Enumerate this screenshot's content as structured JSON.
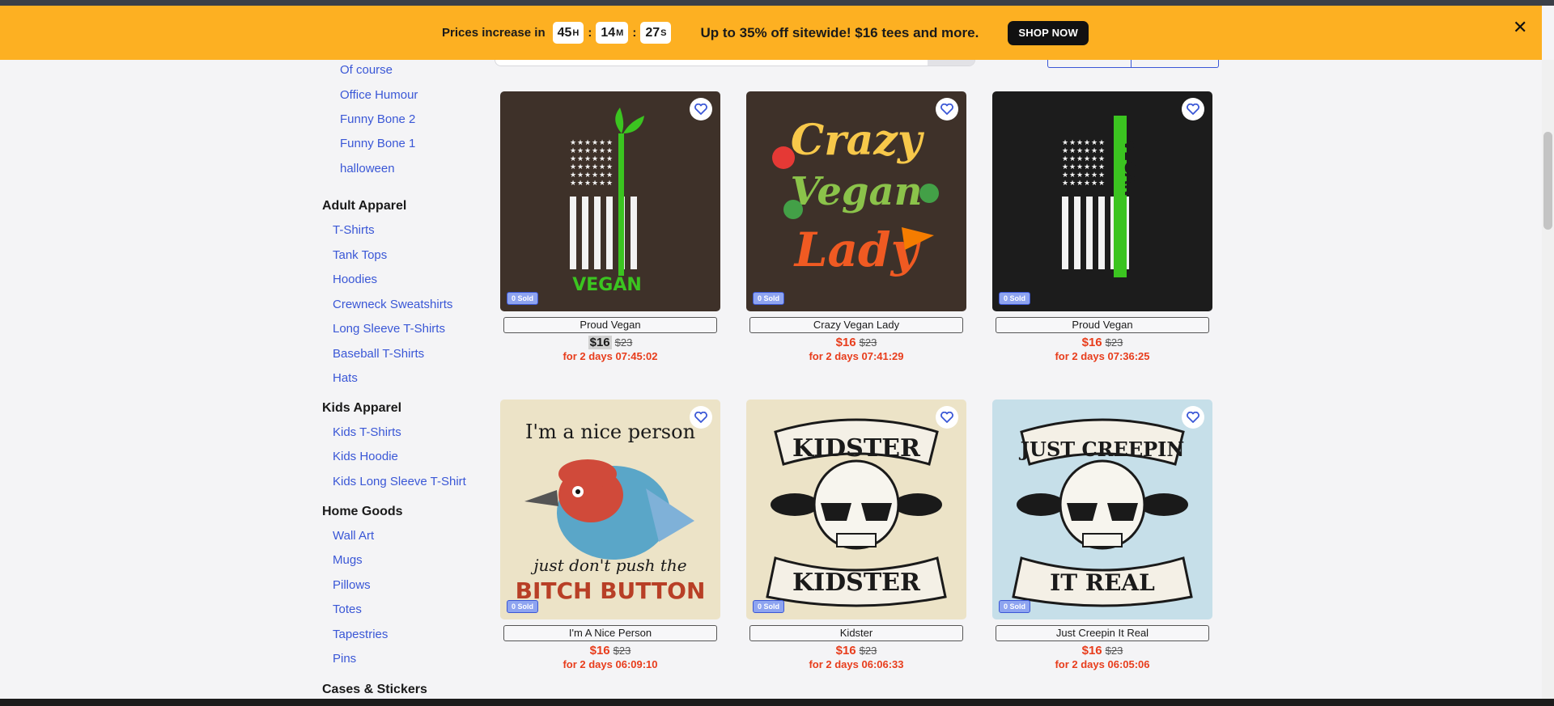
{
  "banner": {
    "prices_text": "Prices increase in",
    "hours": "45",
    "hours_unit": "H",
    "minutes": "14",
    "minutes_unit": "M",
    "seconds": "27",
    "seconds_unit": "S",
    "promo": "Up to 35% off sitewide! $16 tees and more.",
    "shop_now": "SHOP NOW",
    "close": "✕"
  },
  "sidebar": {
    "collections": [
      "Of course",
      "Office Humour",
      "Funny Bone 2",
      "Funny Bone 1",
      "halloween"
    ],
    "adult": {
      "title": "Adult Apparel",
      "items": [
        "T-Shirts",
        "Tank Tops",
        "Hoodies",
        "Crewneck Sweatshirts",
        "Long Sleeve T-Shirts",
        "Baseball T-Shirts",
        "Hats"
      ]
    },
    "kids": {
      "title": "Kids Apparel",
      "items": [
        "Kids T-Shirts",
        "Kids Hoodie",
        "Kids Long Sleeve T-Shirt"
      ]
    },
    "home": {
      "title": "Home Goods",
      "items": [
        "Wall Art",
        "Mugs",
        "Pillows",
        "Totes",
        "Tapestries",
        "Pins"
      ]
    },
    "cases": {
      "title": "Cases & Stickers"
    }
  },
  "products": [
    {
      "name": "Proud Vegan",
      "price": "$16",
      "was": "$23",
      "countdown": "for 2 days 07:45:02",
      "sold": "0 Sold",
      "art": "flag-brown",
      "bg": "#3e3129"
    },
    {
      "name": "Crazy Vegan Lady",
      "price": "$16",
      "was": "$23",
      "countdown": "for 2 days 07:41:29",
      "sold": "0 Sold",
      "art": "crazy",
      "bg": "#3e3129"
    },
    {
      "name": "Proud Vegan",
      "price": "$16",
      "was": "$23",
      "countdown": "for 2 days 07:36:25",
      "sold": "0 Sold",
      "art": "flag-black",
      "bg": "#1c1c1c"
    },
    {
      "name": "I'm A Nice Person",
      "price": "$16",
      "was": "$23",
      "countdown": "for 2 days 06:09:10",
      "sold": "0 Sold",
      "art": "bird",
      "bg": "#ece3c7"
    },
    {
      "name": "Kidster",
      "price": "$16",
      "was": "$23",
      "countdown": "for 2 days 06:06:33",
      "sold": "0 Sold",
      "art": "skull-beige",
      "bg": "#ece3c7"
    },
    {
      "name": "Just Creepin It Real",
      "price": "$16",
      "was": "$23",
      "countdown": "for 2 days 06:05:06",
      "sold": "0 Sold",
      "art": "skull-blue",
      "bg": "#c6dfe9"
    }
  ],
  "art_text": {
    "vegan": "VEGAN",
    "crazy1": "Crazy",
    "crazy2": "Vegan",
    "crazy3": "Lady",
    "bird_top": "I'm a nice person",
    "bird_mid": "just don't push the",
    "bird_bot": "BITCH BUTTON",
    "kid_top": "KIDSTER",
    "kid_bot": "KIDSTER",
    "creep_top": "JUST CREEPIN",
    "creep_bot": "IT REAL"
  },
  "colors": {
    "accent": "#3a57d6",
    "sale": "#e83d1c",
    "banner": "#fdb022"
  }
}
